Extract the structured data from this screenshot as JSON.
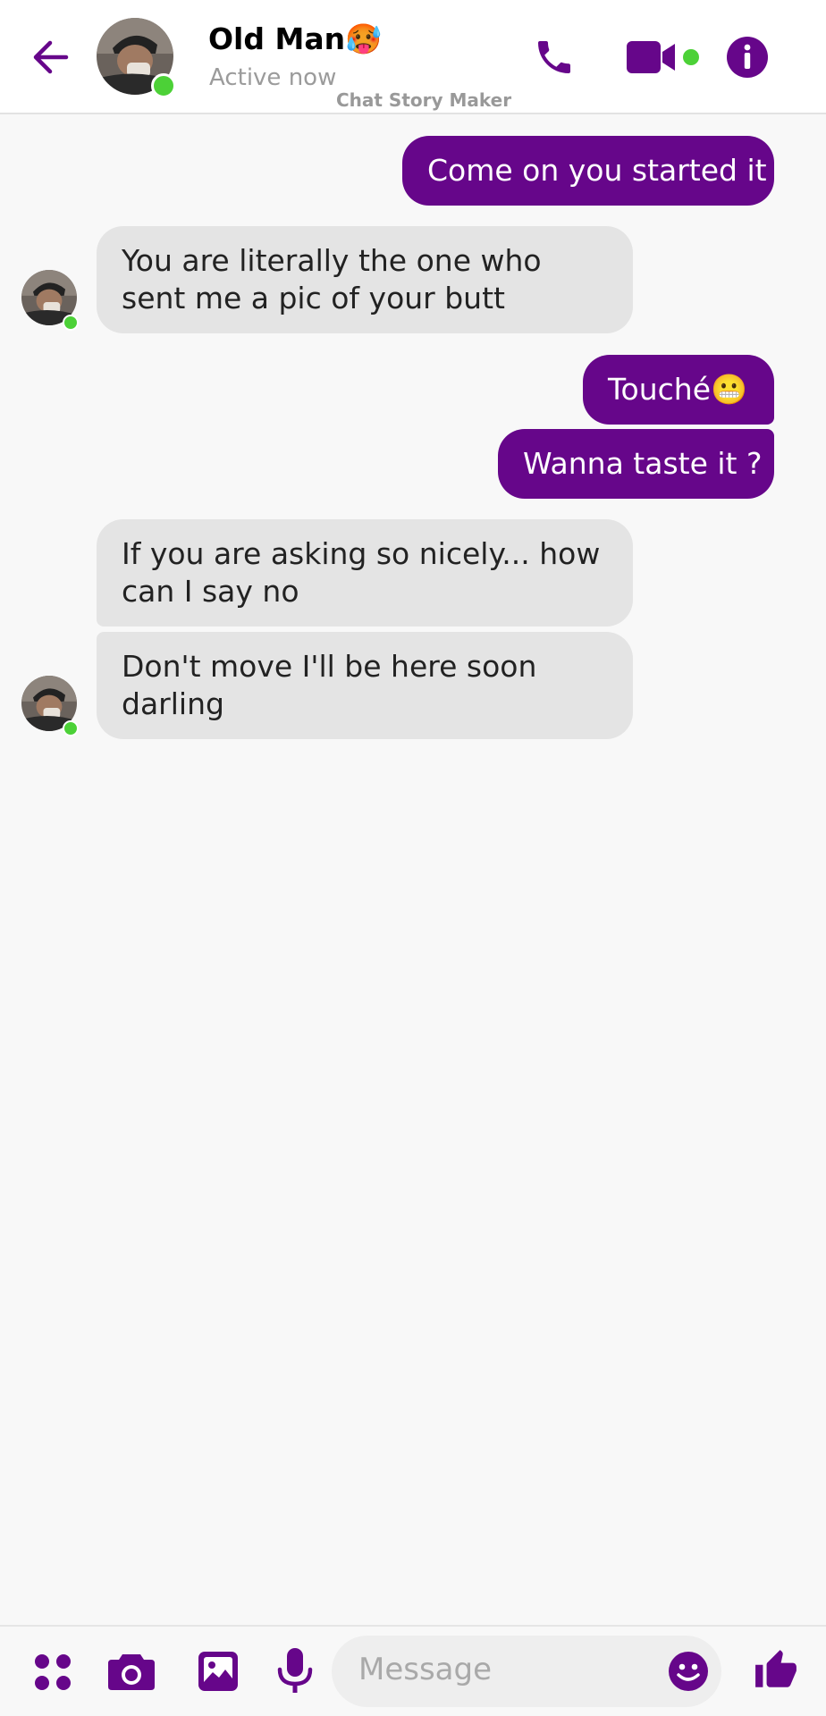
{
  "header": {
    "contact_name": "Old Man🥵",
    "status": "Active now",
    "watermark": "Chat Story Maker"
  },
  "messages": [
    {
      "direction": "out",
      "text": "Come on you started it"
    },
    {
      "direction": "in",
      "text": "You are literally the one who sent me a pic of your butt",
      "avatar": true
    },
    {
      "direction": "out",
      "text": "Touché😬"
    },
    {
      "direction": "out",
      "text": "Wanna taste it ?"
    },
    {
      "direction": "in",
      "text": "If you are asking so nicely... how can I say no",
      "avatar": false
    },
    {
      "direction": "in",
      "text": "Don't move I'll be here soon darling",
      "avatar": true
    }
  ],
  "composer": {
    "placeholder": "Message"
  },
  "icons": {
    "back": "arrow-left-icon",
    "call": "phone-icon",
    "video": "video-camera-icon",
    "info": "info-icon",
    "apps": "grid-dots-icon",
    "camera": "camera-icon",
    "gallery": "image-icon",
    "mic": "microphone-icon",
    "emoji": "smiley-icon",
    "like": "thumbs-up-icon"
  },
  "colors": {
    "accent": "#66068a",
    "online": "#4cd137",
    "incoming_bubble": "#e4e4e4",
    "background": "#f8f8f8"
  }
}
